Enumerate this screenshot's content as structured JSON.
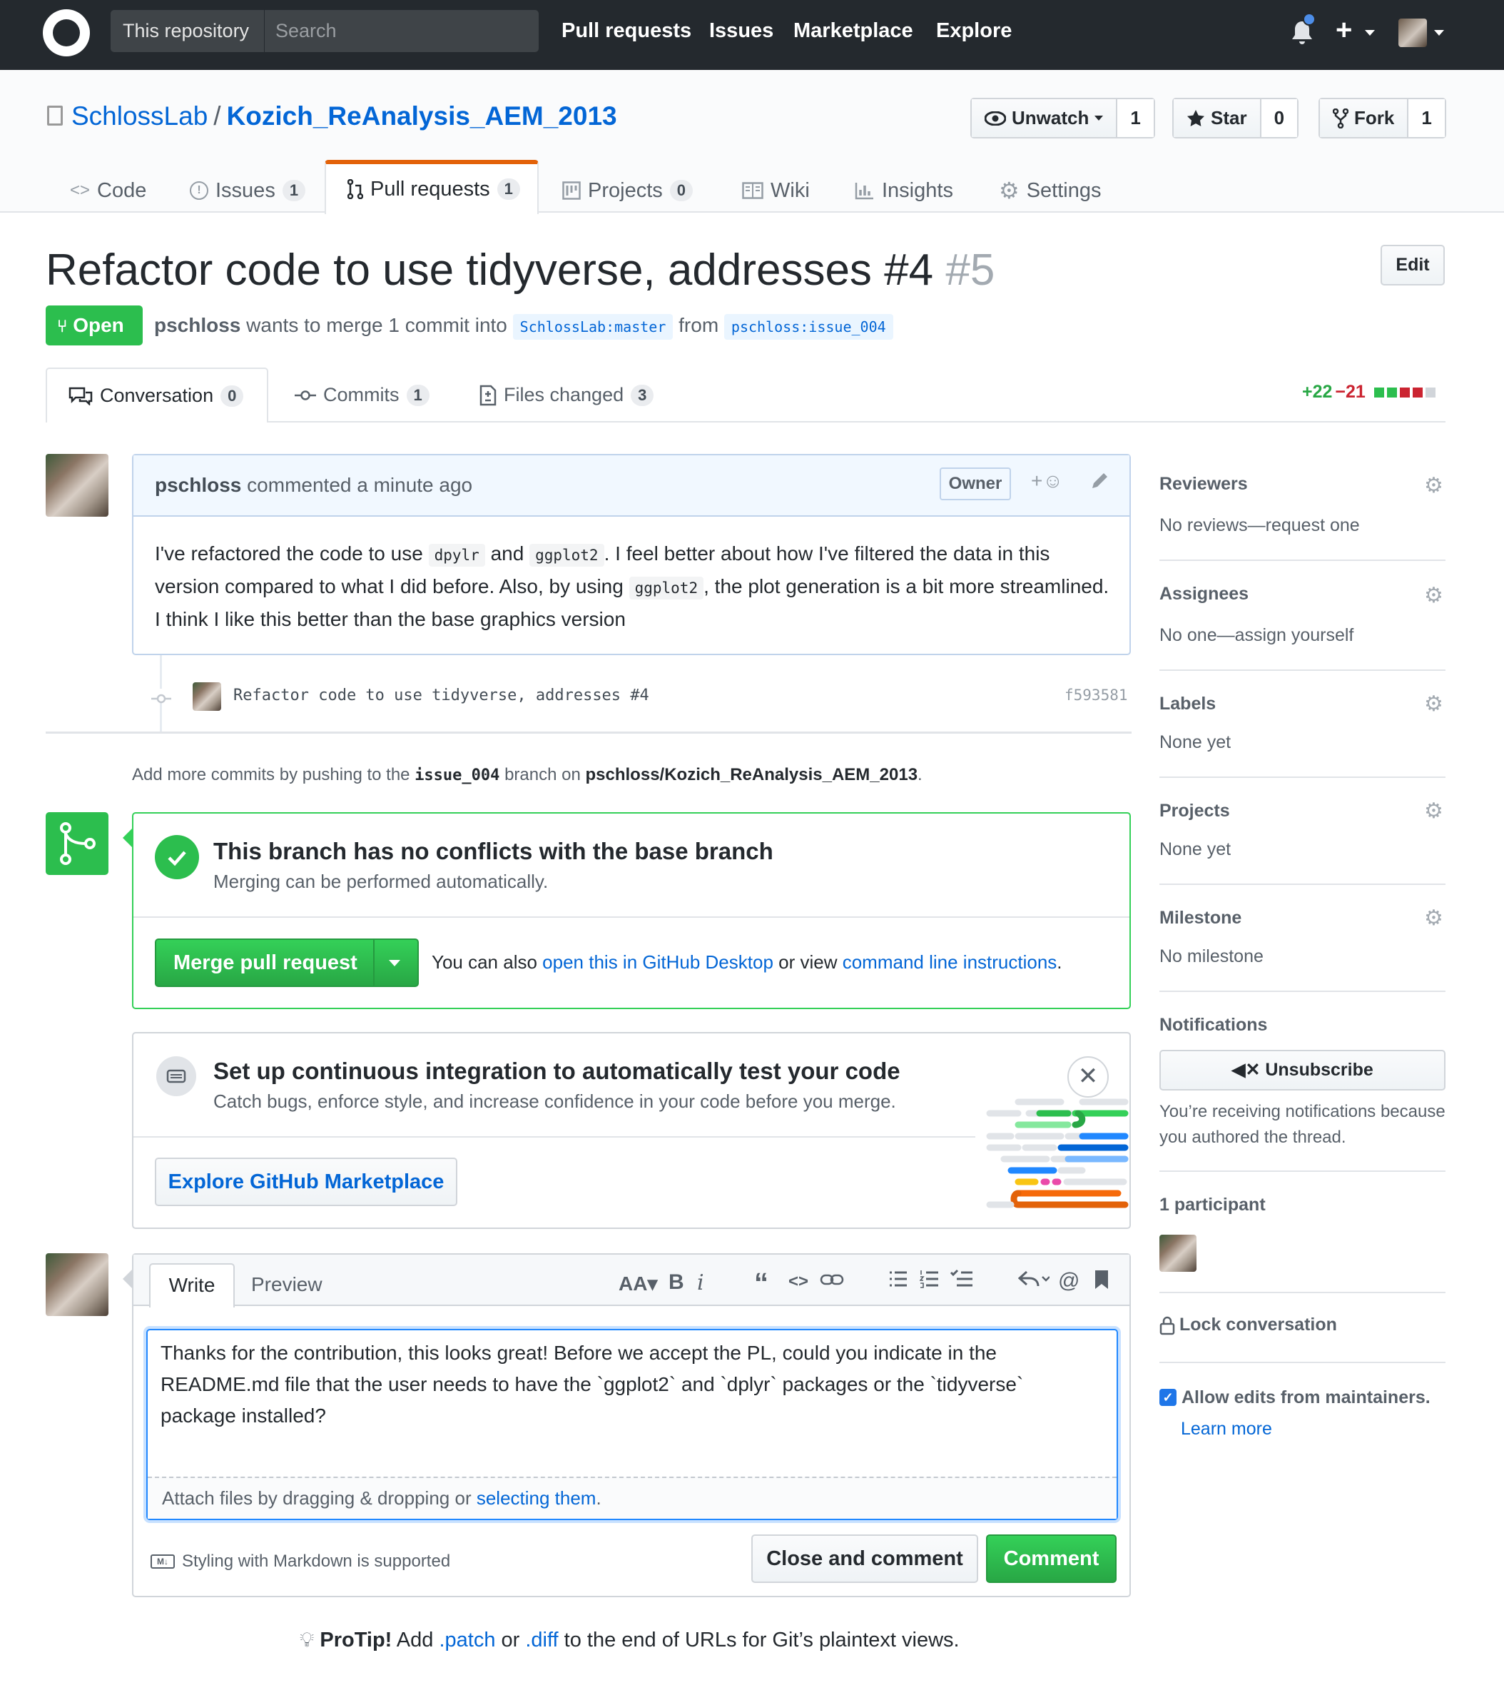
{
  "header": {
    "scope_label": "This repository",
    "search_placeholder": "Search",
    "nav": [
      "Pull requests",
      "Issues",
      "Marketplace",
      "Explore"
    ]
  },
  "repo": {
    "owner": "SchlossLab",
    "separator": "/",
    "name": "Kozich_ReAnalysis_AEM_2013",
    "watch": {
      "label": "Unwatch",
      "count": "1"
    },
    "star": {
      "label": "Star",
      "count": "0"
    },
    "fork": {
      "label": "Fork",
      "count": "1"
    },
    "tabs": [
      {
        "label": "Code",
        "count": ""
      },
      {
        "label": "Issues",
        "count": "1"
      },
      {
        "label": "Pull requests",
        "count": "1"
      },
      {
        "label": "Projects",
        "count": "0"
      },
      {
        "label": "Wiki",
        "count": ""
      },
      {
        "label": "Insights",
        "count": ""
      },
      {
        "label": "Settings",
        "count": ""
      }
    ]
  },
  "pr": {
    "title": "Refactor code to use tidyverse, addresses #4",
    "number": "#5",
    "edit_label": "Edit",
    "state": "Open",
    "author": "pschloss",
    "merge_text": "wants to merge 1 commit into",
    "base": "SchlossLab:master",
    "from_text": "from",
    "head": "pschloss:issue_004",
    "subtabs": [
      {
        "label": "Conversation",
        "count": "0"
      },
      {
        "label": "Commits",
        "count": "1"
      },
      {
        "label": "Files changed",
        "count": "3"
      }
    ],
    "additions": "+22",
    "deletions": "−21"
  },
  "comment": {
    "author": "pschloss",
    "meta": "commented a minute ago",
    "badge": "Owner",
    "body": {
      "p1": "I've refactored the code to use ",
      "c1": "dpylr",
      "p2": " and ",
      "c2": "ggplot2",
      "p3": ". I feel better about how I've filtered the data in this version compared to what I did before. Also, by using ",
      "c3": "ggplot2",
      "p4": ", the plot generation is a bit more streamlined. I think I like this better than the base graphics version"
    }
  },
  "commit": {
    "message": "Refactor code to use tidyverse, addresses #4",
    "sha": "f593581"
  },
  "push_note": {
    "t1": "Add more commits by pushing to the ",
    "branch": "issue_004",
    "t2": " branch on ",
    "repo": "pschloss/Kozich_ReAnalysis_AEM_2013",
    "t3": "."
  },
  "merge": {
    "title": "This branch has no conflicts with the base branch",
    "subtitle": "Merging can be performed automatically.",
    "button": "Merge pull request",
    "also_text": "You can also ",
    "desktop_link": "open this in GitHub Desktop",
    "or_text": " or view ",
    "cli_link": "command line instructions",
    "period": "."
  },
  "ci": {
    "title": "Set up continuous integration to automatically test your code",
    "subtitle": "Catch bugs, enforce style, and increase confidence in your code before you merge.",
    "button": "Explore GitHub Marketplace",
    "close": "✕"
  },
  "new_comment": {
    "tab_write": "Write",
    "tab_preview": "Preview",
    "text": "Thanks for the contribution, this looks great! Before we accept the PL,  could you indicate in the README.md file that the user needs to have the `ggplot2` and `dplyr` packages or the `tidyverse` package installed?",
    "attach_text": "Attach files by dragging & dropping or ",
    "attach_link": "selecting them",
    "attach_end": ".",
    "markdown_note": "Styling with Markdown is supported",
    "markdown_icon_text": "M↓",
    "close_button": "Close and comment",
    "comment_button": "Comment"
  },
  "protip": {
    "bold": "ProTip!",
    "t1": " Add ",
    "l1": ".patch",
    "t2": " or ",
    "l2": ".diff",
    "t3": " to the end of URLs for Git’s plaintext views."
  },
  "sidebar": {
    "reviewers": {
      "title": "Reviewers",
      "value": "No reviews—request one"
    },
    "assignees": {
      "title": "Assignees",
      "value": "No one—assign yourself"
    },
    "labels": {
      "title": "Labels",
      "value": "None yet"
    },
    "projects": {
      "title": "Projects",
      "value": "None yet"
    },
    "milestone": {
      "title": "Milestone",
      "value": "No milestone"
    },
    "notifications": {
      "title": "Notifications",
      "button": "Unsubscribe",
      "note": "You’re receiving notifications because you authored the thread."
    },
    "participants": {
      "title": "1 participant"
    },
    "lock": "Lock conversation",
    "allow_edits": "Allow edits from maintainers.",
    "learn_more": "Learn more"
  },
  "colors": {
    "accent": "#0366d6",
    "green": "#2cbe4e",
    "red": "#cb2431",
    "tab_orange": "#e36209"
  },
  "icons": [
    "github-logo-icon",
    "bell-icon",
    "plus-icon",
    "repo-icon",
    "eye-icon",
    "star-icon",
    "fork-icon",
    "code-icon",
    "issue-icon",
    "pull-request-icon",
    "project-icon",
    "wiki-icon",
    "graph-icon",
    "gear-icon",
    "conversation-icon",
    "commit-icon",
    "file-diff-icon",
    "emoji-icon",
    "pencil-icon",
    "merge-icon",
    "check-icon",
    "ci-icon",
    "mute-icon",
    "lock-icon",
    "light-bulb-icon",
    "markdown-icon"
  ]
}
